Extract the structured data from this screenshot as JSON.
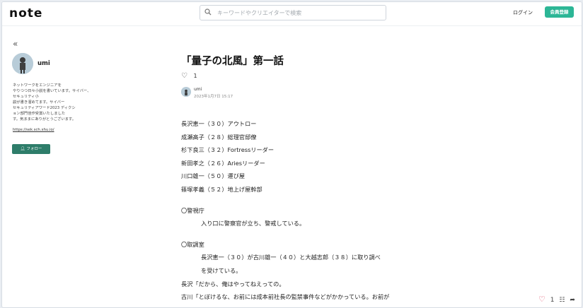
{
  "header": {
    "logo": "note",
    "search_placeholder": "キーワードやクリエイターで検索",
    "login": "ログイン",
    "signup": "会員登録"
  },
  "sidebar": {
    "collapse_icon": "«",
    "author": "umi",
    "bio": "ネットワークをエンジニアを\nやりつつ日々小説を書いています。サイバー、セキュリティ小\n説が書き溜めてます。サイバー\nセキュリティアワード2023 ディクシ\nョン部門佳作受賞いたしました\nす。気ままにありがとうございます。",
    "link": "https://sek.sch.xhu.io/",
    "follow": "フォロー"
  },
  "article": {
    "title": "「量子の北風」第一話",
    "likes": "1",
    "author": "umi",
    "date": "2023年1月7日 15:17",
    "lines": [
      {
        "text": "長沢恵一（３０）アウトロー",
        "type": "normal"
      },
      {
        "text": "成瀬高子（２８）総理官邸僚",
        "type": "normal"
      },
      {
        "text": "杉下良三（３２）Fortressリーダー",
        "type": "normal"
      },
      {
        "text": "新田孝之（２６）Ariesリーダー",
        "type": "normal"
      },
      {
        "text": "川口雄一（５０）運び屋",
        "type": "normal"
      },
      {
        "text": "篠塚孝義（５２）地上げ屋幹部",
        "type": "normal"
      },
      {
        "text": "",
        "type": "gap"
      },
      {
        "text": "〇警視庁",
        "type": "normal"
      },
      {
        "text": "入り口に警察官が立ち、警戒している。",
        "type": "indent"
      },
      {
        "text": "",
        "type": "gap"
      },
      {
        "text": "〇取調室",
        "type": "normal"
      },
      {
        "text": "長沢恵一（３０）が古川雄一（４０）と大越志郎（３８）に取り調べ",
        "type": "indent"
      },
      {
        "text": "を受けている。",
        "type": "indent"
      },
      {
        "text": "長沢「だから、俺はやってねえっての。",
        "type": "normal"
      },
      {
        "text": "古川「とぼけるな、お前には成本前社長の監禁事件などがかかっている。お前が",
        "type": "normal"
      }
    ]
  },
  "bottom_bar": {
    "likes": "1"
  }
}
